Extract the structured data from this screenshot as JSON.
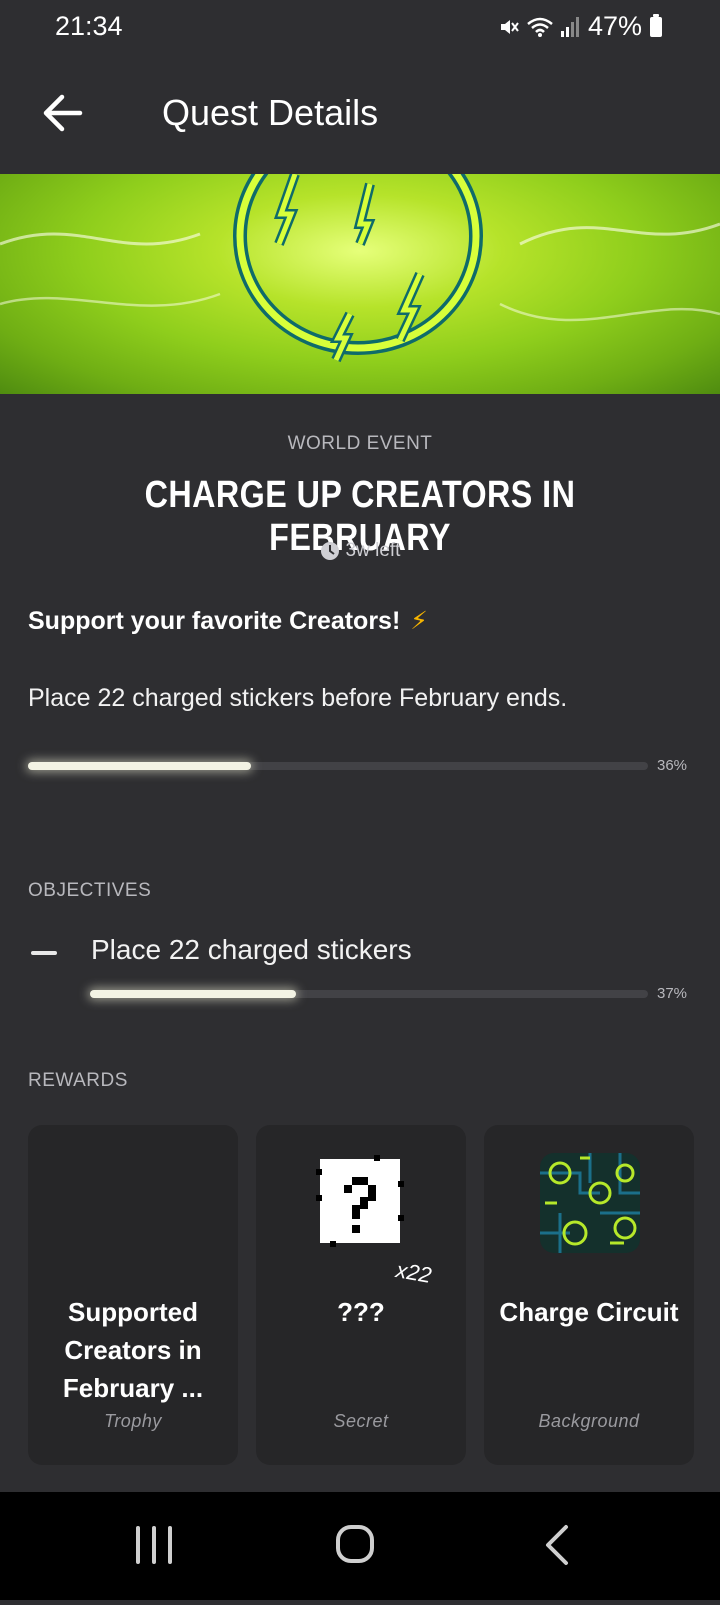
{
  "status": {
    "time": "21:34",
    "battery": "47%",
    "icons": [
      "mute-icon",
      "wifi-icon",
      "signal-icon",
      "battery-icon"
    ]
  },
  "header": {
    "title": "Quest Details",
    "back_icon": "arrow-left-icon"
  },
  "quest": {
    "category": "WORLD EVENT",
    "title": "CHARGE UP CREATORS IN FEBRUARY",
    "time_left": "3w left",
    "tagline": "Support your favorite Creators!",
    "tagline_emoji": "⚡",
    "description": "Place 22 charged stickers before February ends.",
    "progress_pct": 36,
    "progress_label": "36%"
  },
  "objectives": {
    "label": "OBJECTIVES",
    "items": [
      {
        "text": "Place 22 charged stickers",
        "progress_pct": 37,
        "progress_label": "37%"
      }
    ]
  },
  "rewards": {
    "label": "REWARDS",
    "items": [
      {
        "name": "Supported Creators in February ...",
        "type": "Trophy"
      },
      {
        "name": "???",
        "type": "Secret",
        "count": "x22"
      },
      {
        "name": "Charge Circuit",
        "type": "Background"
      }
    ]
  },
  "colors": {
    "background": "#2e2e31",
    "card": "#262628",
    "accent_green": "#c8f52a",
    "progress": "#f3f3e4"
  }
}
